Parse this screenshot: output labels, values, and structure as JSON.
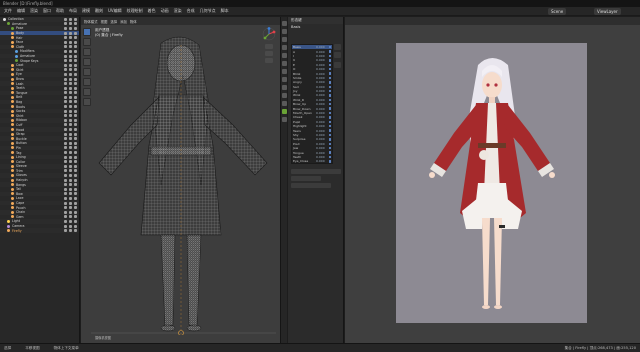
{
  "app": {
    "title": "Blender [D:\\Firefly.blend]"
  },
  "menubar": {
    "items": [
      "文件",
      "编辑",
      "渲染",
      "窗口",
      "帮助",
      "布局",
      "建模",
      "雕刻",
      "UV编辑",
      "纹理绘制",
      "着色",
      "动画",
      "渲染",
      "合成",
      "几何节点",
      "脚本"
    ],
    "scene": "Scene",
    "view_layer": "ViewLayer"
  },
  "outliner": {
    "rows": [
      {
        "label": "Collection",
        "type": "collection"
      },
      {
        "label": "Armature",
        "type": "armature"
      },
      {
        "label": "Pose",
        "type": "pose"
      },
      {
        "label": "Body",
        "type": "mesh"
      },
      {
        "label": "Hair",
        "type": "mesh"
      },
      {
        "label": "Face",
        "type": "mesh"
      },
      {
        "label": "Cloth",
        "type": "mesh"
      },
      {
        "label": "Modifiers",
        "type": "modifier"
      },
      {
        "label": "Armature",
        "type": "modifier"
      },
      {
        "label": "Shape Keys",
        "type": "data"
      },
      {
        "label": "Coat",
        "type": "mesh"
      },
      {
        "label": "Skirt",
        "type": "mesh"
      },
      {
        "label": "Eye",
        "type": "mesh"
      },
      {
        "label": "Brow",
        "type": "mesh"
      },
      {
        "label": "Lash",
        "type": "mesh"
      },
      {
        "label": "Teeth",
        "type": "mesh"
      },
      {
        "label": "Tongue",
        "type": "mesh"
      },
      {
        "label": "Belt",
        "type": "mesh"
      },
      {
        "label": "Bag",
        "type": "mesh"
      },
      {
        "label": "Boots",
        "type": "mesh"
      },
      {
        "label": "Socks",
        "type": "mesh"
      },
      {
        "label": "Shirt",
        "type": "mesh"
      },
      {
        "label": "Ribbon",
        "type": "mesh"
      },
      {
        "label": "Cuff",
        "type": "mesh"
      },
      {
        "label": "Hood",
        "type": "mesh"
      },
      {
        "label": "Strap",
        "type": "mesh"
      },
      {
        "label": "Buckle",
        "type": "mesh"
      },
      {
        "label": "Button",
        "type": "mesh"
      },
      {
        "label": "Pin",
        "type": "mesh"
      },
      {
        "label": "Tag",
        "type": "mesh"
      },
      {
        "label": "Lining",
        "type": "mesh"
      },
      {
        "label": "Collar",
        "type": "mesh"
      },
      {
        "label": "Sleeve",
        "type": "mesh"
      },
      {
        "label": "Trim",
        "type": "mesh"
      },
      {
        "label": "Gloves",
        "type": "mesh"
      },
      {
        "label": "Hairpin",
        "type": "mesh"
      },
      {
        "label": "Bangs",
        "type": "mesh"
      },
      {
        "label": "Tail",
        "type": "mesh"
      },
      {
        "label": "Bow",
        "type": "mesh"
      },
      {
        "label": "Lace",
        "type": "mesh"
      },
      {
        "label": "Cape",
        "type": "mesh"
      },
      {
        "label": "Pouch",
        "type": "mesh"
      },
      {
        "label": "Chain",
        "type": "mesh"
      },
      {
        "label": "Gem",
        "type": "mesh"
      },
      {
        "label": "Light",
        "type": "light"
      },
      {
        "label": "Camera",
        "type": "camera"
      },
      {
        "label": "Firefly",
        "type": "orange"
      }
    ]
  },
  "viewport": {
    "mode": "物体模式",
    "menus": [
      "视图",
      "选择",
      "添加",
      "物体"
    ],
    "info_line1": "用户透视",
    "info_line2": "(0) 集合 | Firefly",
    "stats": "摄像机视图"
  },
  "props": {
    "header": "形态键",
    "sub": "Basis"
  },
  "shape_keys": [
    {
      "name": "Basis",
      "value": "0.000"
    },
    {
      "name": "A",
      "value": "0.000"
    },
    {
      "name": "I",
      "value": "0.000"
    },
    {
      "name": "U",
      "value": "0.000"
    },
    {
      "name": "E",
      "value": "0.000"
    },
    {
      "name": "O",
      "value": "0.000"
    },
    {
      "name": "Blink",
      "value": "0.000"
    },
    {
      "name": "Smile",
      "value": "0.000"
    },
    {
      "name": "Angry",
      "value": "0.000"
    },
    {
      "name": "Sad",
      "value": "0.000"
    },
    {
      "name": "Joy",
      "value": "0.000"
    },
    {
      "name": "Wink",
      "value": "0.000"
    },
    {
      "name": "Wink_R",
      "value": "0.000"
    },
    {
      "name": "Brow_Up",
      "value": "0.000"
    },
    {
      "name": "Brow_Down",
      "value": "0.000"
    },
    {
      "name": "Mouth_Open",
      "value": "0.000"
    },
    {
      "name": "Cheek",
      "value": "0.000"
    },
    {
      "name": "Pupil",
      "value": "0.000"
    },
    {
      "name": "Highlight",
      "value": "0.000"
    },
    {
      "name": "Tears",
      "value": "0.000"
    },
    {
      "name": "Shy",
      "value": "0.000"
    },
    {
      "name": "Surprise",
      "value": "0.000"
    },
    {
      "name": "Pout",
      "value": "0.000"
    },
    {
      "name": "Jaw",
      "value": "0.000"
    },
    {
      "name": "Tongue",
      "value": "0.000"
    },
    {
      "name": "Teeth",
      "value": "0.000"
    },
    {
      "name": "Eye_Close",
      "value": "0.000"
    }
  ],
  "status": {
    "left": "选择",
    "mid": "平移视图",
    "mid2": "物体上下文菜单",
    "right": "集合 | Firefly | 顶点:268,473 | 面:255,120"
  },
  "colors": {
    "accent": "#4772b3",
    "selection": "#334d80",
    "canvas": "#8d8a93",
    "coat": "#a62a2c"
  }
}
